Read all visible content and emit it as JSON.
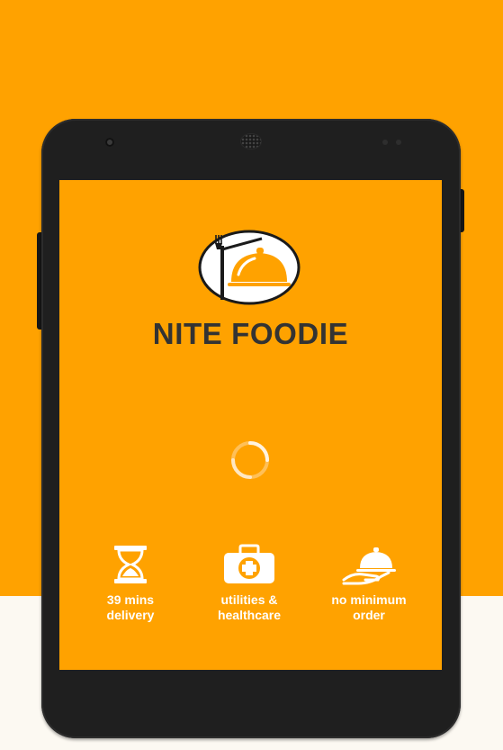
{
  "app": {
    "title": "NITE FOODIE"
  },
  "features": [
    {
      "icon": "hourglass-icon",
      "line1": "39 mins",
      "line2": "delivery"
    },
    {
      "icon": "first-aid-kit-icon",
      "line1": "utilities &",
      "line2": "healthcare"
    },
    {
      "icon": "serving-cloche-icon",
      "line1": "no minimum",
      "line2": "order"
    }
  ],
  "colors": {
    "brand_orange": "#FFA200",
    "title_text": "#333333",
    "device_body": "#1F1F1F",
    "bottom_band": "#FCF9F2"
  }
}
